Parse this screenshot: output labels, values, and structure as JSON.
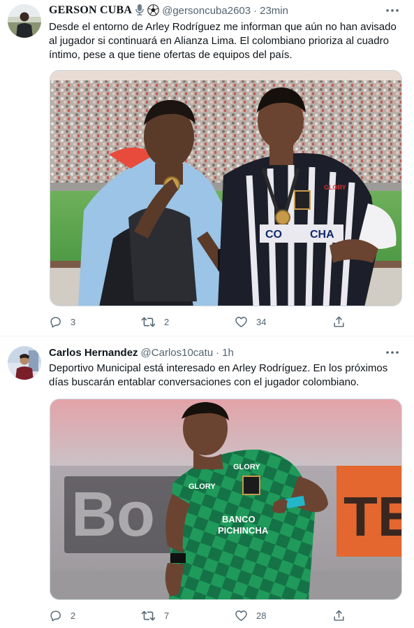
{
  "tweets": [
    {
      "author": {
        "name": "GERSON CUBA",
        "handle": "@gersoncuba2603",
        "badges": [
          "microphone-icon",
          "soccer-ball-icon"
        ]
      },
      "separator": "·",
      "time": "23min",
      "text_lines": [
        "Desde el entorno de Arley Rodríguez me informan que aún no han avisado",
        "al jugador si continuará en Alianza Lima. El colombiano prioriza al cuadro",
        "íntimo, pese a que tiene ofertas de equipos del país."
      ],
      "media": {
        "kit_text": [
          "GLORY",
          "CO",
          "CHA"
        ]
      },
      "stats": {
        "replies": "3",
        "retweets": "2",
        "likes": "34"
      }
    },
    {
      "author": {
        "name": "Carlos Hernandez",
        "handle": "@Carlos10catu"
      },
      "separator": "·",
      "time": "1h",
      "text_lines": [
        "Deportivo Municipal está interesado en Arley Rodríguez. En los próximos",
        "días buscarán entablar conversaciones con el jugador colombiano."
      ],
      "media": {
        "kit_text": [
          "GLORY",
          "GLORY",
          "BANCO",
          "PICHINCHA"
        ],
        "background_text": "Bo",
        "background_text_2": "TE"
      },
      "stats": {
        "replies": "2",
        "retweets": "7",
        "likes": "28"
      }
    }
  ],
  "colors": {
    "text": "#0f1419",
    "secondary": "#536471",
    "border": "#cfd9de",
    "divider": "#eff3f4"
  }
}
